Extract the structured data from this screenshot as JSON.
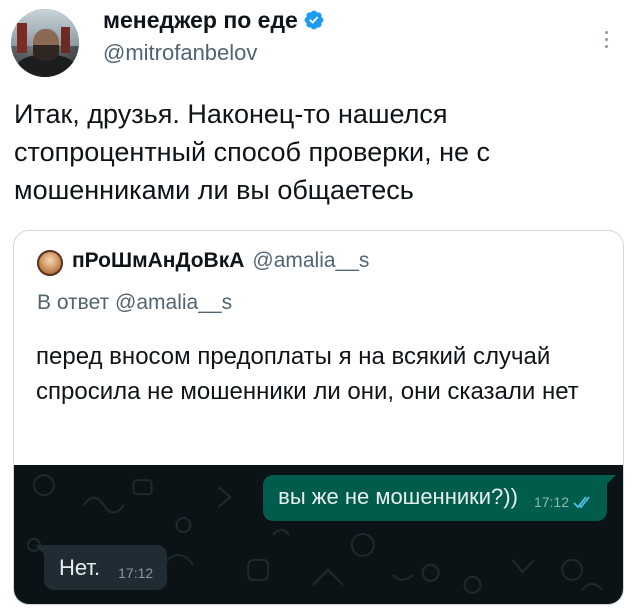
{
  "tweet": {
    "author_name": "менеджер по еде",
    "author_handle": "@mitrofanbelov",
    "text": "Итак, друзья. Наконец-то нашелся стопроцентный способ проверки, не с мошенниками ли вы общаетесь",
    "verified_color": "#1d9bf0"
  },
  "quoted_tweet": {
    "author_name": "пРоШмАнДоВкА",
    "author_handle": "@amalia__s",
    "reply_prefix": "В ответ",
    "reply_handle": "@amalia__s",
    "text": "перед вносом предоплаты я на всякий случай спросила не мошенники ли они, они сказали нет"
  },
  "chat": {
    "outgoing": {
      "text": "вы же не мошенники?))",
      "time": "17:12",
      "status_icon": "double-check-icon",
      "bubble_color": "#005c4b"
    },
    "incoming": {
      "text": "Нет.",
      "time": "17:12",
      "bubble_color": "#202c33"
    },
    "background_color": "#0c1317"
  }
}
